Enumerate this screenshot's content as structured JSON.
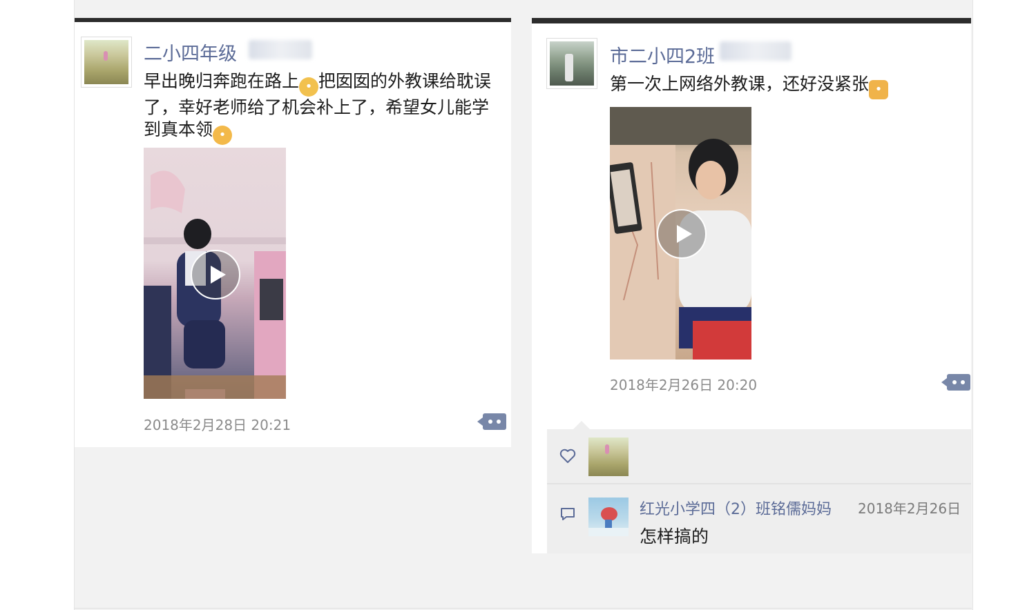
{
  "posts": [
    {
      "author": "二小四年级",
      "text_lines": [
        "早出晚归奔跑在路上",
        "把囡囡的外教课给耽误",
        "了，幸好老师给了机会补上了，希望女儿能学",
        "到真本领"
      ],
      "emoji_1": "sweat-face",
      "emoji_2": "happy-face",
      "timestamp": "2018年2月28日 20:21"
    },
    {
      "author": "市二小四2班",
      "text": "第一次上网络外教课，还好没紧张",
      "emoji": "thumbs-up",
      "timestamp": "2018年2月26日 20:20",
      "comment": {
        "author": "红光小学四（2）班铭儒妈妈",
        "date": "2018年2月26日",
        "text": "怎样搞的"
      }
    }
  ],
  "colors": {
    "name_blue": "#5b6b97",
    "comment_btn": "#7887a8",
    "panel_topbar": "#2c2c2c"
  }
}
